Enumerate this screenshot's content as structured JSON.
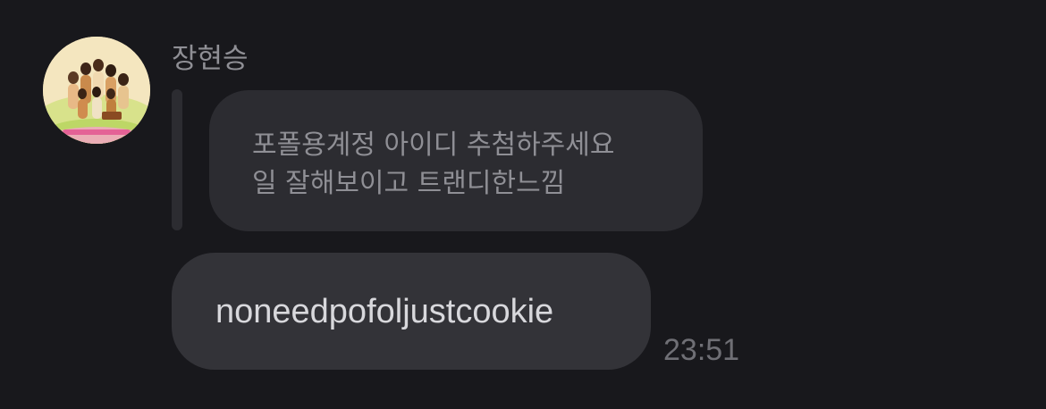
{
  "sender": {
    "name": "장현승",
    "avatar_icon": "group-photo-avatar"
  },
  "reply": {
    "quoted_lines": [
      "포폴용계정 아이디 추첨하주세요",
      "일 잘해보이고 트랜디한느낌"
    ]
  },
  "message": {
    "text": "noneedpofoljustcookie",
    "time": "23:51"
  },
  "colors": {
    "background": "#18181c",
    "quoted_bubble": "#2c2c31",
    "message_bubble": "#333338",
    "muted_text": "#8f8f95",
    "message_text": "#d8d8dc",
    "timestamp": "#6f6f75"
  }
}
